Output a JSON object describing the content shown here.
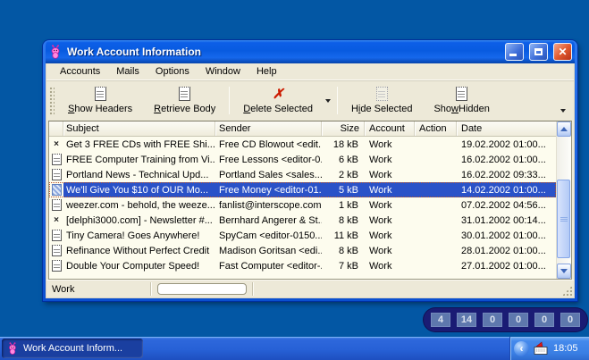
{
  "window": {
    "title": "Work Account Information",
    "controls": {
      "minimize": "minimize",
      "maximize": "maximize",
      "close": "close"
    },
    "menu": [
      "Accounts",
      "Mails",
      "Options",
      "Window",
      "Help"
    ],
    "toolbar": {
      "buttons": [
        {
          "pre": "",
          "u": "S",
          "post": "how Headers",
          "icon": "notes-icon"
        },
        {
          "pre": "",
          "u": "R",
          "post": "etrieve Body",
          "icon": "notes-icon"
        },
        {
          "pre": "",
          "u": "D",
          "post": "elete Selected",
          "icon": "red-x-icon",
          "has_dropdown": true
        },
        {
          "pre": "H",
          "u": "i",
          "post": "de Selected",
          "icon": "notes-disabled-icon"
        },
        {
          "pre": "Sho",
          "u": "w",
          "post": " Hidden",
          "icon": "notes-icon"
        }
      ]
    },
    "table": {
      "columns": [
        "Subject",
        "Sender",
        "Size",
        "Account",
        "Action",
        "Date"
      ],
      "rows": [
        {
          "icon": "x-mark-icon",
          "subject": "Get 3 FREE CDs with FREE Shi...",
          "sender": "Free CD Blowout <edit...",
          "size": "18 kB",
          "account": "Work",
          "action": "",
          "date": "19.02.2002 01:00...",
          "selected": false
        },
        {
          "icon": "note-icon",
          "subject": "FREE Computer Training from Vi...",
          "sender": "Free Lessons <editor-0...",
          "size": "6 kB",
          "account": "Work",
          "action": "",
          "date": "16.02.2002 01:00...",
          "selected": false
        },
        {
          "icon": "note-icon",
          "subject": "Portland News - Technical Upd...",
          "sender": "Portland Sales <sales...",
          "size": "2 kB",
          "account": "Work",
          "action": "",
          "date": "16.02.2002 09:33...",
          "selected": false
        },
        {
          "icon": "hatch-icon",
          "subject": "We'll Give You $10 of OUR Mo...",
          "sender": "Free Money <editor-01...",
          "size": "5 kB",
          "account": "Work",
          "action": "",
          "date": "14.02.2002 01:00...",
          "selected": true
        },
        {
          "icon": "note-icon",
          "subject": "weezer.com - behold, the weeze...",
          "sender": "fanlist@interscope.com",
          "size": "1 kB",
          "account": "Work",
          "action": "",
          "date": "07.02.2002 04:56...",
          "selected": false
        },
        {
          "icon": "x-mark-icon",
          "subject": "[delphi3000.com] - Newsletter #...",
          "sender": "Bernhard Angerer & St...",
          "size": "8 kB",
          "account": "Work",
          "action": "",
          "date": "31.01.2002 00:14...",
          "selected": false
        },
        {
          "icon": "note-icon",
          "subject": "Tiny Camera! Goes Anywhere!",
          "sender": "SpyCam <editor-0150...",
          "size": "11 kB",
          "account": "Work",
          "action": "",
          "date": "30.01.2002 01:00...",
          "selected": false
        },
        {
          "icon": "note-icon",
          "subject": "Refinance Without Perfect Credit",
          "sender": "Madison Goritsan <edi...",
          "size": "8 kB",
          "account": "Work",
          "action": "",
          "date": "28.01.2002 01:00...",
          "selected": false
        },
        {
          "icon": "note-icon",
          "subject": "Double Your Computer Speed!",
          "sender": "Fast Computer <editor-...",
          "size": "7 kB",
          "account": "Work",
          "action": "",
          "date": "27.01.2002 01:00...",
          "selected": false
        }
      ]
    },
    "statusbar": {
      "account": "Work"
    }
  },
  "tray_panel": {
    "counts": [
      "4",
      "14",
      "0",
      "0",
      "0",
      "0"
    ]
  },
  "taskbar": {
    "task_button": "Work Account Inform...",
    "clock": "18:05"
  },
  "colors": {
    "desktop": "#0357A4",
    "selection": "#2A52C8",
    "panel_bg": "#1A1C74",
    "count_box": "#5E78AD",
    "close_button": "#E15C31"
  }
}
